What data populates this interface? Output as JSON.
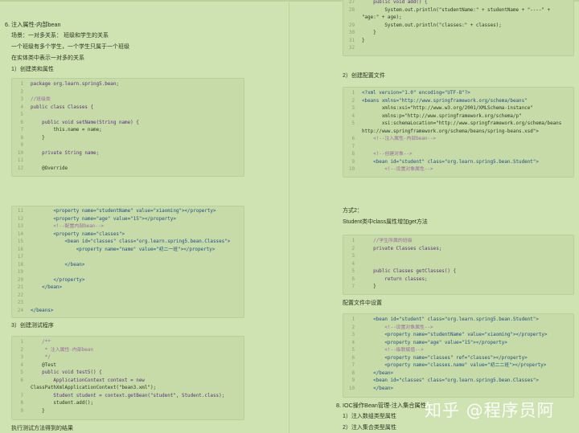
{
  "left": {
    "heading": "6. 注入属性-内部bean",
    "scenario": "场景：一对多关系： 班级和学生的关系",
    "note1": "一个班级有多个学生，一个学生只属于一个班级",
    "note2": "在实体类中表示一对多的关系",
    "step1": "1）创建类和属性",
    "code1": [
      {
        "n": "1",
        "t": "package org.learn.spring5.bean;"
      },
      {
        "n": "2",
        "t": ""
      },
      {
        "n": "3",
        "t": "//班级类"
      },
      {
        "n": "4",
        "t": "public class Classes {"
      },
      {
        "n": "5",
        "t": ""
      },
      {
        "n": "6",
        "t": "    public void setName(String name) {"
      },
      {
        "n": "7",
        "t": "        this.name = name;"
      },
      {
        "n": "8",
        "t": "    }"
      },
      {
        "n": "9",
        "t": ""
      },
      {
        "n": "10",
        "t": "    private String name;"
      },
      {
        "n": "11",
        "t": ""
      },
      {
        "n": "12",
        "t": "    @Override"
      }
    ],
    "code2": [
      {
        "n": "11",
        "t": "        <property name=\"studentName\" value=\"xiaoming\"></property>"
      },
      {
        "n": "12",
        "t": "        <property name=\"age\" value=\"15\"></property>"
      },
      {
        "n": "13",
        "t": "        <!--配置内部bean-->"
      },
      {
        "n": "14",
        "t": "        <property name=\"classes\">"
      },
      {
        "n": "15",
        "t": "            <bean id=\"classes\" class=\"org.learn.spring5.bean.Classes\">"
      },
      {
        "n": "16",
        "t": "                <property name=\"name\" value=\"初二一班\"></property>"
      },
      {
        "n": "17",
        "t": ""
      },
      {
        "n": "18",
        "t": "            </bean>"
      },
      {
        "n": "19",
        "t": ""
      },
      {
        "n": "20",
        "t": "        </property>"
      },
      {
        "n": "21",
        "t": "    </bean>"
      },
      {
        "n": "22",
        "t": ""
      },
      {
        "n": "23",
        "t": ""
      },
      {
        "n": "24",
        "t": "</beans>"
      }
    ],
    "step3": "3）创建测试程序",
    "code3": [
      {
        "n": "1",
        "t": "    /**"
      },
      {
        "n": "2",
        "t": "     * 注入属性-内部bean"
      },
      {
        "n": "3",
        "t": "     */"
      },
      {
        "n": "4",
        "t": "    @Test"
      },
      {
        "n": "5",
        "t": "    public void test5() {"
      },
      {
        "n": "6",
        "t": "        ApplicationContext context = new"
      },
      {
        "n": "",
        "t": "ClassPathXmlApplicationContext(\"bean3.xml\");"
      },
      {
        "n": "7",
        "t": "        Student student = context.getBean(\"student\", Student.class);"
      },
      {
        "n": "8",
        "t": "        student.add();"
      },
      {
        "n": "9",
        "t": "    }"
      }
    ],
    "bottom_cut": "执行测试方法得到的结果"
  },
  "right": {
    "code_top": [
      {
        "n": "27",
        "t": "    public void add() {"
      },
      {
        "n": "28",
        "t": "        System.out.println(\"studentName:\" + studentName + \"----\" +"
      },
      {
        "n": "",
        "t": "\"age:\" + age);"
      },
      {
        "n": "29",
        "t": "        System.out.println(\"classes:\" + classes);"
      },
      {
        "n": "30",
        "t": "    }"
      },
      {
        "n": "31",
        "t": "}"
      },
      {
        "n": "32",
        "t": ""
      }
    ],
    "step2": "2）创建配置文件",
    "code_cfg": [
      {
        "n": "1",
        "t": "<?xml version=\"1.0\" encoding=\"UTF-8\"?>"
      },
      {
        "n": "2",
        "t": "<beans xmlns=\"http://www.springframework.org/schema/beans\""
      },
      {
        "n": "3",
        "t": "       xmlns:xsi=\"http://www.w3.org/2001/XMLSchema-instance\""
      },
      {
        "n": "4",
        "t": "       xmlns:p=\"http://www.springframework.org/schema/p\""
      },
      {
        "n": "5",
        "t": "       xsi:schemaLocation=\"http://www.springframework.org/schema/beans"
      },
      {
        "n": "",
        "t": "http://www.springframework.org/schema/beans/spring-beans.xsd\">"
      },
      {
        "n": "6",
        "t": "    <!--注入属性-内部bean-->"
      },
      {
        "n": "7",
        "t": ""
      },
      {
        "n": "8",
        "t": "    <!--创建对象-->"
      },
      {
        "n": "9",
        "t": "    <bean id=\"student\" class=\"org.learn.spring5.bean.Student\">"
      },
      {
        "n": "10",
        "t": "        <!--设置对象属性-->"
      }
    ],
    "method2": "方式2：",
    "method2_desc": "Student类中class属性增加get方法",
    "code_get": [
      {
        "n": "1",
        "t": "    //学生所属的班级"
      },
      {
        "n": "2",
        "t": "    private Classes classes;"
      },
      {
        "n": "3",
        "t": ""
      },
      {
        "n": "4",
        "t": ""
      },
      {
        "n": "5",
        "t": "    public Classes getClasses() {"
      },
      {
        "n": "6",
        "t": "        return classes;"
      },
      {
        "n": "7",
        "t": "    }"
      }
    ],
    "cfg_label": "配置文件中设置",
    "code_cfg2": [
      {
        "n": "1",
        "t": "    <bean id=\"student\" class=\"org.learn.spring5.bean.Student\">"
      },
      {
        "n": "2",
        "t": "        <!--设置对象属性-->"
      },
      {
        "n": "3",
        "t": "        <property name=\"studentName\" value=\"xiaoming\"></property>"
      },
      {
        "n": "4",
        "t": "        <property name=\"age\" value=\"15\"></property>"
      },
      {
        "n": "5",
        "t": "        <!--级联赋值-->"
      },
      {
        "n": "6",
        "t": "        <property name=\"classes\" ref=\"classes\"></property>"
      },
      {
        "n": "7",
        "t": "        <property name=\"classes.name\" value=\"初二二班\"></property>"
      },
      {
        "n": "8",
        "t": "    </bean>"
      },
      {
        "n": "9",
        "t": "    <bean id=\"classes\" class=\"org.learn.spring5.bean.Classes\">"
      },
      {
        "n": "10",
        "t": "    </bean>"
      }
    ],
    "section8": "8. IOC操作Bean管理-注入集合属性",
    "s8_1": "1）注入数组类型属性",
    "s8_2": "2）注入集合类型属性"
  },
  "watermark": "知乎 @程序员阿"
}
